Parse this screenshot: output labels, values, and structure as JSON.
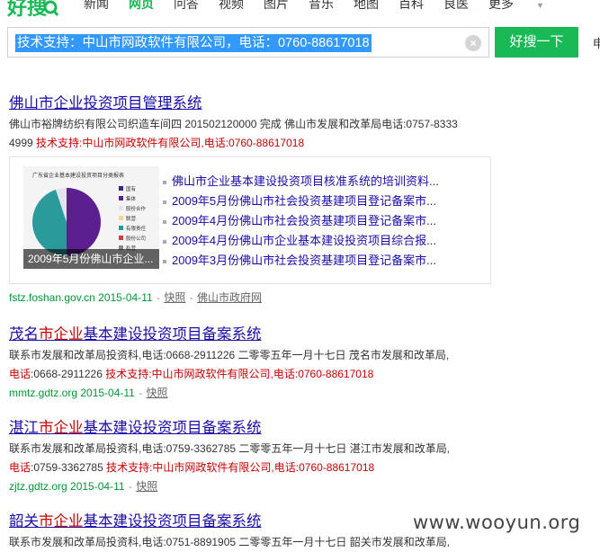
{
  "header": {
    "logo_text": "好搜",
    "nav": [
      "新闻",
      "网页",
      "问答",
      "视频",
      "图片",
      "音乐",
      "地图",
      "百科",
      "良医",
      "更多"
    ],
    "active_nav": "网页",
    "search_value": "技术支持：中山市网政软件有限公司，电话：0760-88617018",
    "search_button": "好搜一下",
    "edge_char": "申",
    "clear_icon": "close-circle-icon",
    "more_icon": "caret-down-icon"
  },
  "results": [
    {
      "title_pre": "佛山市企业投资项目管理系统",
      "desc_line1": "佛山市裕牌纺织有限公司织造车间四 201502120000 完成 佛山市发展和改革局电话:0757-8333",
      "desc_line2_pre": "4999 ",
      "desc_highlight": "技术支持:中山市网政软件有限公司,电话:0760-88617018",
      "url": "fstz.foshan.gov.cn 2015-04-11",
      "snapshot": "快照",
      "site_name": "佛山市政府网",
      "thumb_caption": "2009年5月份佛山市企业...",
      "thumb_title": "广东省企业基本建设投资项目分类报表",
      "thumb_legend": [
        "国有",
        "集体",
        "股份合作",
        "联营",
        "有限责任",
        "股份公司",
        "私营"
      ],
      "links": [
        "佛山市企业基本建设投资项目核准系统的培训资料...",
        "2009年5月份佛山市社会投资基建项目登记备案市...",
        "2009年4月份佛山市社会投资基建项目登记备案市...",
        "2009年4月份佛山市企业基本建设投资项目综合报...",
        "2009年3月份佛山市社会投资基建项目登记备案市..."
      ]
    },
    {
      "title_a": "茂名",
      "title_b": "市企业",
      "title_c": "基本建设投资项目备案系统",
      "desc_line1": "联系市发展和改革局投资科,电话:0668-2911226 二零零五年一月十七日 茂名市发展和改革局,",
      "desc_line2_a": "电话",
      "desc_line2_b": ":0668-2911226 ",
      "desc_highlight": "技术支持:中山市网政软件有限公司,电话:0760-88617018",
      "url": "mmtz.gdtz.org 2015-04-11",
      "snapshot": "快照"
    },
    {
      "title_a": "湛江",
      "title_b": "市企业",
      "title_c": "基本建设投资项目备案系统",
      "desc_line1": "联系市发展和改革局投资科,电话:0759-3362785 二零零五年一月十七日 湛江市发展和改革局,",
      "desc_line2_a": "电话",
      "desc_line2_b": ":0759-3362785 ",
      "desc_highlight": "技术支持:中山市网政软件有限公司,电话:0760-88617018",
      "url": "zjtz.gdtz.org 2015-04-11",
      "snapshot": "快照"
    },
    {
      "title_a": "韶关",
      "title_b": "市企业",
      "title_c": "基本建设投资项目备案系统",
      "desc_line1": "联系市发展和改革局投资科,电话:0751-8891905 二零零五年一月十七日 韶关市发展和改革局,"
    }
  ],
  "watermark": "www.wooyun.org"
}
